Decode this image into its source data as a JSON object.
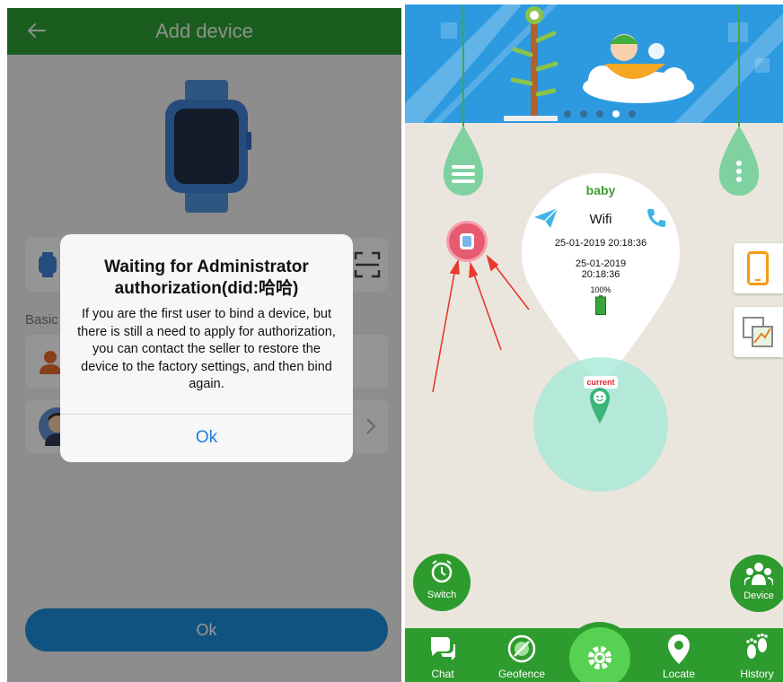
{
  "left": {
    "header_title": "Add device",
    "basic_label": "Basic",
    "bottom_button_label": "Ok",
    "dialog": {
      "title": "Waiting for Administrator authorization(did:哈哈)",
      "message": "If you are the first user to bind a device, but there is still a need to apply for authorization, you can contact the seller to restore the device to the factory settings, and then bind again.",
      "ok_label": "Ok"
    },
    "colors": {
      "header": "#2e9b34",
      "button": "#1b8ad6",
      "dialog_ok": "#1a7de0"
    }
  },
  "right": {
    "banner_dots_total": 5,
    "banner_dot_active": 4,
    "info": {
      "name": "baby",
      "network": "Wifi",
      "time_primary": "25-01-2019 20:18:36",
      "time_secondary_date": "25-01-2019",
      "time_secondary_time": "20:18:36",
      "battery": "100%"
    },
    "map": {
      "current_label": "current"
    },
    "round_buttons": {
      "switch_label": "Switch",
      "device_label": "Device"
    },
    "tabs": [
      {
        "label": "Chat",
        "icon": "chat-icon"
      },
      {
        "label": "Geofence",
        "icon": "geofence-icon"
      },
      {
        "label": "",
        "icon": "gear-icon"
      },
      {
        "label": "Locate",
        "icon": "locate-pin-icon"
      },
      {
        "label": "History",
        "icon": "footprints-icon"
      }
    ],
    "colors": {
      "bar": "#2e9b2e",
      "accent": "#56d151",
      "pin": "#e85a6f",
      "current": "#e3262b"
    }
  }
}
